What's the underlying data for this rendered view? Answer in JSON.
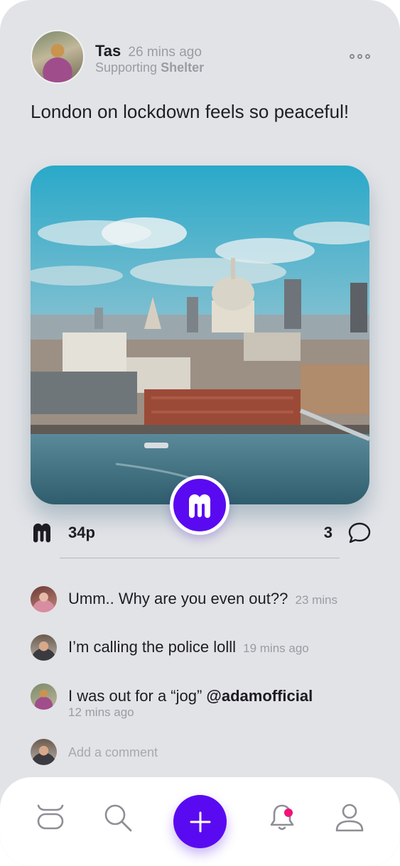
{
  "post": {
    "author": "Tas",
    "time": "26 mins ago",
    "supporting_prefix": "Supporting",
    "supporting_org": "Shelter",
    "text": "London on lockdown feels so peaceful!",
    "points": "34p",
    "comment_count": "3"
  },
  "comments": [
    {
      "text": "Umm.. Why are you even out??",
      "time": "23 mins"
    },
    {
      "text": "I’m calling the police lolll",
      "time": "19 mins ago"
    },
    {
      "text": "I was out for a “jog” ",
      "mention": "@adamofficial",
      "time": "12 mins ago"
    }
  ],
  "composer": {
    "placeholder": "Add a comment"
  },
  "nav": {
    "items": [
      "home-icon",
      "search-icon",
      "plus-icon",
      "bell-icon",
      "profile-icon"
    ]
  },
  "colors": {
    "accent": "#5a0af0",
    "notification": "#f0137a",
    "background": "#e2e3e7"
  }
}
